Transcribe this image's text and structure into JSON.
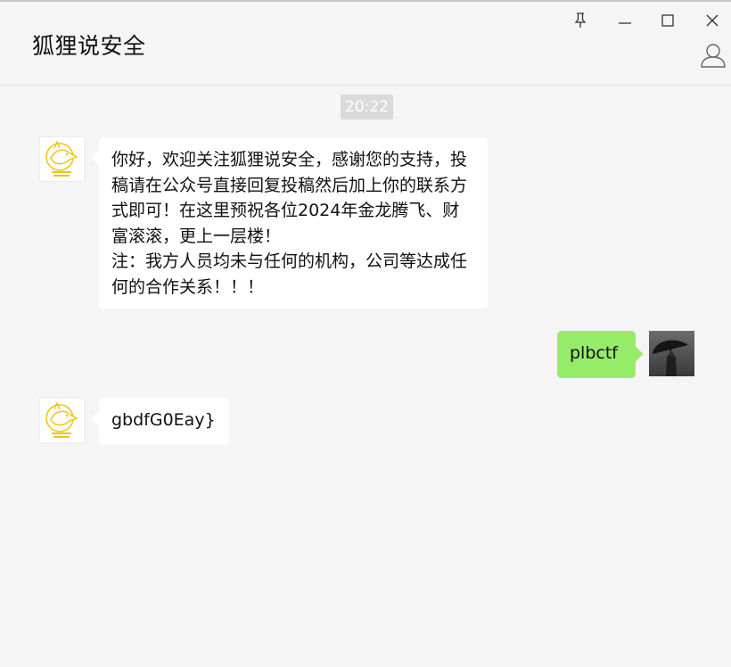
{
  "window": {
    "title": "狐狸说安全",
    "controls": {
      "pin_icon": "pin-icon",
      "minimize_icon": "minimize-icon",
      "maximize_icon": "maximize-icon",
      "close_icon": "close-icon",
      "profile_icon": "person-icon"
    }
  },
  "chat": {
    "timestamp": "20:22",
    "messages": [
      {
        "direction": "incoming",
        "sender_avatar": "fox-logo-avatar",
        "text": "你好，欢迎关注狐狸说安全，感谢您的支持，投稿请在公众号直接回复投稿然后加上你的联系方式即可！在这里预祝各位2024年金龙腾飞、财富滚滚，更上一层楼！\n注：我方人员均未与任何的机构，公司等达成任何的合作关系！！！"
      },
      {
        "direction": "outgoing",
        "sender_avatar": "umbrella-photo-avatar",
        "text": "plbctf"
      },
      {
        "direction": "incoming",
        "sender_avatar": "fox-logo-avatar",
        "text": "gbdfG0Eay}"
      }
    ]
  },
  "colors": {
    "background": "#f5f5f5",
    "incoming_bubble": "#ffffff",
    "outgoing_bubble": "#95ec69",
    "timestamp_bg": "#dadada",
    "logo_gold": "#f0c419"
  }
}
